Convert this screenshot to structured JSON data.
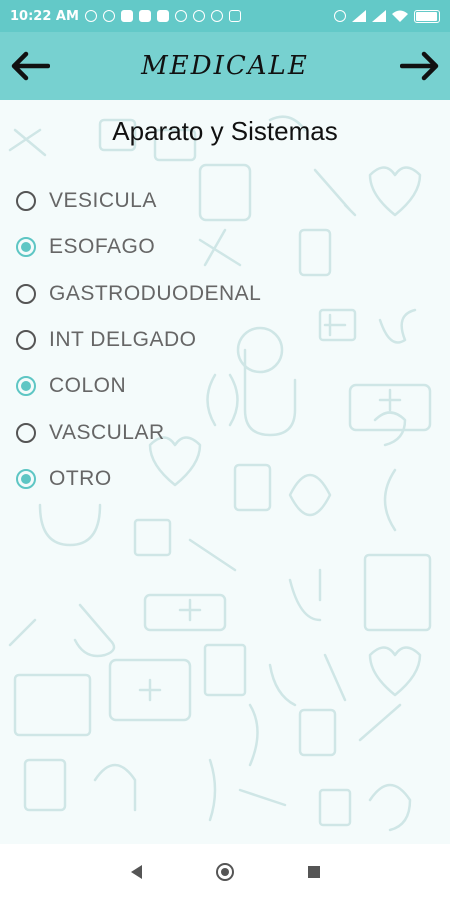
{
  "status_bar": {
    "time": "10:22 AM",
    "left_icons": [
      "whatsapp-icon",
      "circle-icon",
      "facebook-icon",
      "facebook-icon",
      "facebook-icon",
      "runner-icon",
      "circle-icon",
      "runner-icon",
      "laptop-icon"
    ],
    "right_icons": [
      "alarm-icon",
      "signal-icon",
      "signal-icon",
      "wifi-icon"
    ],
    "battery_level": 0.95,
    "color": "#63c9c8"
  },
  "app_bar": {
    "title": "MEDICALE",
    "back_icon": "arrow-left-icon",
    "forward_icon": "arrow-right-icon",
    "color": "#77d1d0"
  },
  "heading": "Aparato y Sistemas",
  "options": [
    {
      "label": "VESICULA",
      "checked": false
    },
    {
      "label": "ESOFAGO",
      "checked": true
    },
    {
      "label": "GASTRODUODENAL",
      "checked": false
    },
    {
      "label": "INT DELGADO",
      "checked": false
    },
    {
      "label": "COLON",
      "checked": true
    },
    {
      "label": "VASCULAR",
      "checked": false
    },
    {
      "label": "OTRO",
      "checked": true
    }
  ],
  "accent_color": "#5ec6c4",
  "nav_bar": {
    "icons": [
      "back-triangle-icon",
      "home-circle-icon",
      "recent-square-icon"
    ]
  }
}
